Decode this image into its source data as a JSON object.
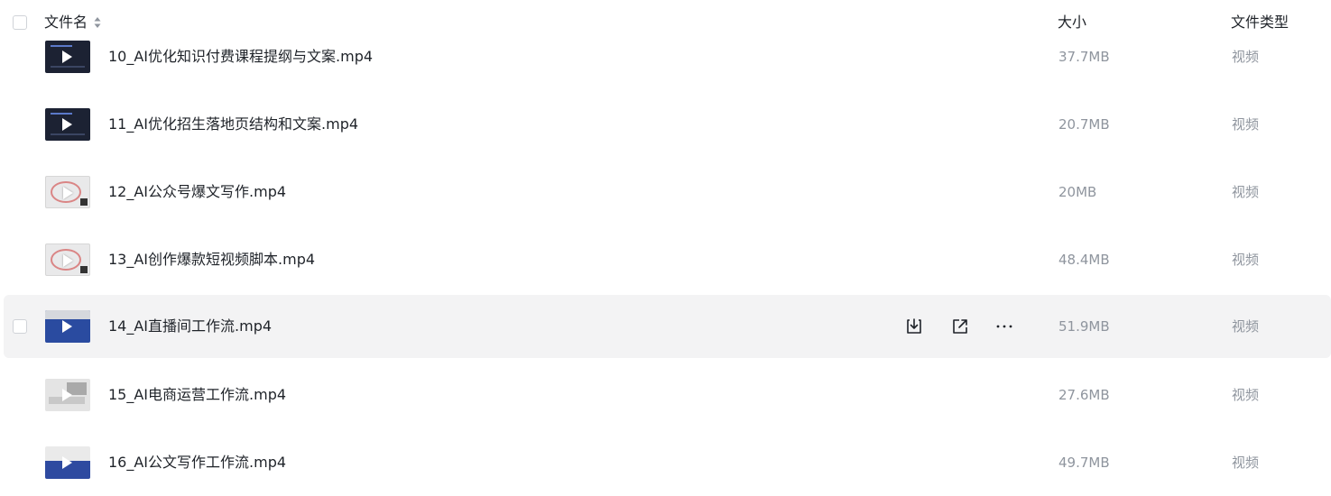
{
  "header": {
    "name_label": "文件名",
    "size_label": "大小",
    "type_label": "文件类型"
  },
  "files": [
    {
      "name": "10_AI优化知识付费课程提纲与文案.mp4",
      "size": "37.7MB",
      "type": "视频"
    },
    {
      "name": "11_AI优化招生落地页结构和文案.mp4",
      "size": "20.7MB",
      "type": "视频"
    },
    {
      "name": "12_AI公众号爆文写作.mp4",
      "size": "20MB",
      "type": "视频"
    },
    {
      "name": "13_AI创作爆款短视频脚本.mp4",
      "size": "48.4MB",
      "type": "视频"
    },
    {
      "name": "14_AI直播间工作流.mp4",
      "size": "51.9MB",
      "type": "视频"
    },
    {
      "name": "15_AI电商运营工作流.mp4",
      "size": "27.6MB",
      "type": "视频"
    },
    {
      "name": "16_AI公文写作工作流.mp4",
      "size": "49.7MB",
      "type": "视频"
    }
  ],
  "row_actions": {
    "icons": [
      "download-icon",
      "share-icon",
      "more-icon"
    ]
  }
}
